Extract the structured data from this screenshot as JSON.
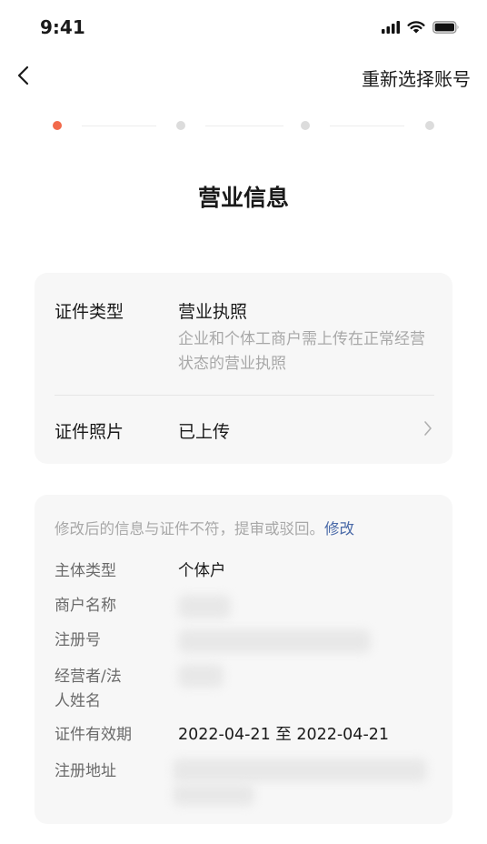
{
  "status_bar": {
    "time": "9:41"
  },
  "nav": {
    "reselect_label": "重新选择账号"
  },
  "stepper": {
    "total": 4,
    "current": 1
  },
  "page": {
    "title": "营业信息"
  },
  "cert_card": {
    "type_label": "证件类型",
    "type_value": "营业执照",
    "type_desc": "企业和个体工商户需上传在正常经营状态的营业执照",
    "photo_label": "证件照片",
    "photo_value": "已上传"
  },
  "info_card": {
    "notice": "修改后的信息与证件不符，提审或驳回。",
    "edit_label": "修改",
    "subject_type_label": "主体类型",
    "subject_type_value": "个体户",
    "merchant_name_label": "商户名称",
    "reg_no_label": "注册号",
    "operator_label_line1": "经营者/法",
    "operator_label_line2": "人姓名",
    "validity_label": "证件有效期",
    "validity_value": "2022-04-21 至 2022-04-21",
    "address_label": "注册地址"
  },
  "colors": {
    "accent": "#f26a4b",
    "link": "#4a6aa8"
  }
}
